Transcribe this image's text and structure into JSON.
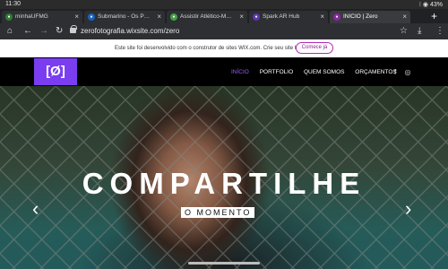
{
  "status_bar": {
    "time": "11:30",
    "right": "⁝ ◉ 43%"
  },
  "tabs": [
    {
      "title": "minhaUFMG",
      "favicon": "ufmg-icon",
      "favicon_color": "#2e7d32"
    },
    {
      "title": "Submarino - Os Produtos",
      "favicon": "submarino-icon",
      "favicon_color": "#1565c0"
    },
    {
      "title": "Assistir Atlético-MG x Co",
      "favicon": "atletico-icon",
      "favicon_color": "#43a047"
    },
    {
      "title": "Spark AR Hub",
      "favicon": "spark-ar-icon",
      "favicon_color": "#5e35b1"
    },
    {
      "title": "INÍCIO | Zero",
      "favicon": "wix-icon",
      "favicon_color": "#8e24aa"
    }
  ],
  "new_tab_label": "+",
  "browser": {
    "url": "zerofotografia.wixsite.com/zero"
  },
  "wix_banner": {
    "text": "Este site foi desenvolvido com o construtor de sites WIX.com. Crie seu site hoje.",
    "cta": "Comece já"
  },
  "site": {
    "logo_text": "[Ø]",
    "nav": [
      "INÍCIO",
      "PORTFOLIO",
      "QUEM SOMOS",
      "ORÇAMENTOS"
    ],
    "social": [
      "f",
      "◎"
    ]
  },
  "hero": {
    "title": "COMPARTILHE",
    "subtitle": "O MOMENTO",
    "prev_arrow": "‹",
    "next_arrow": "›"
  }
}
